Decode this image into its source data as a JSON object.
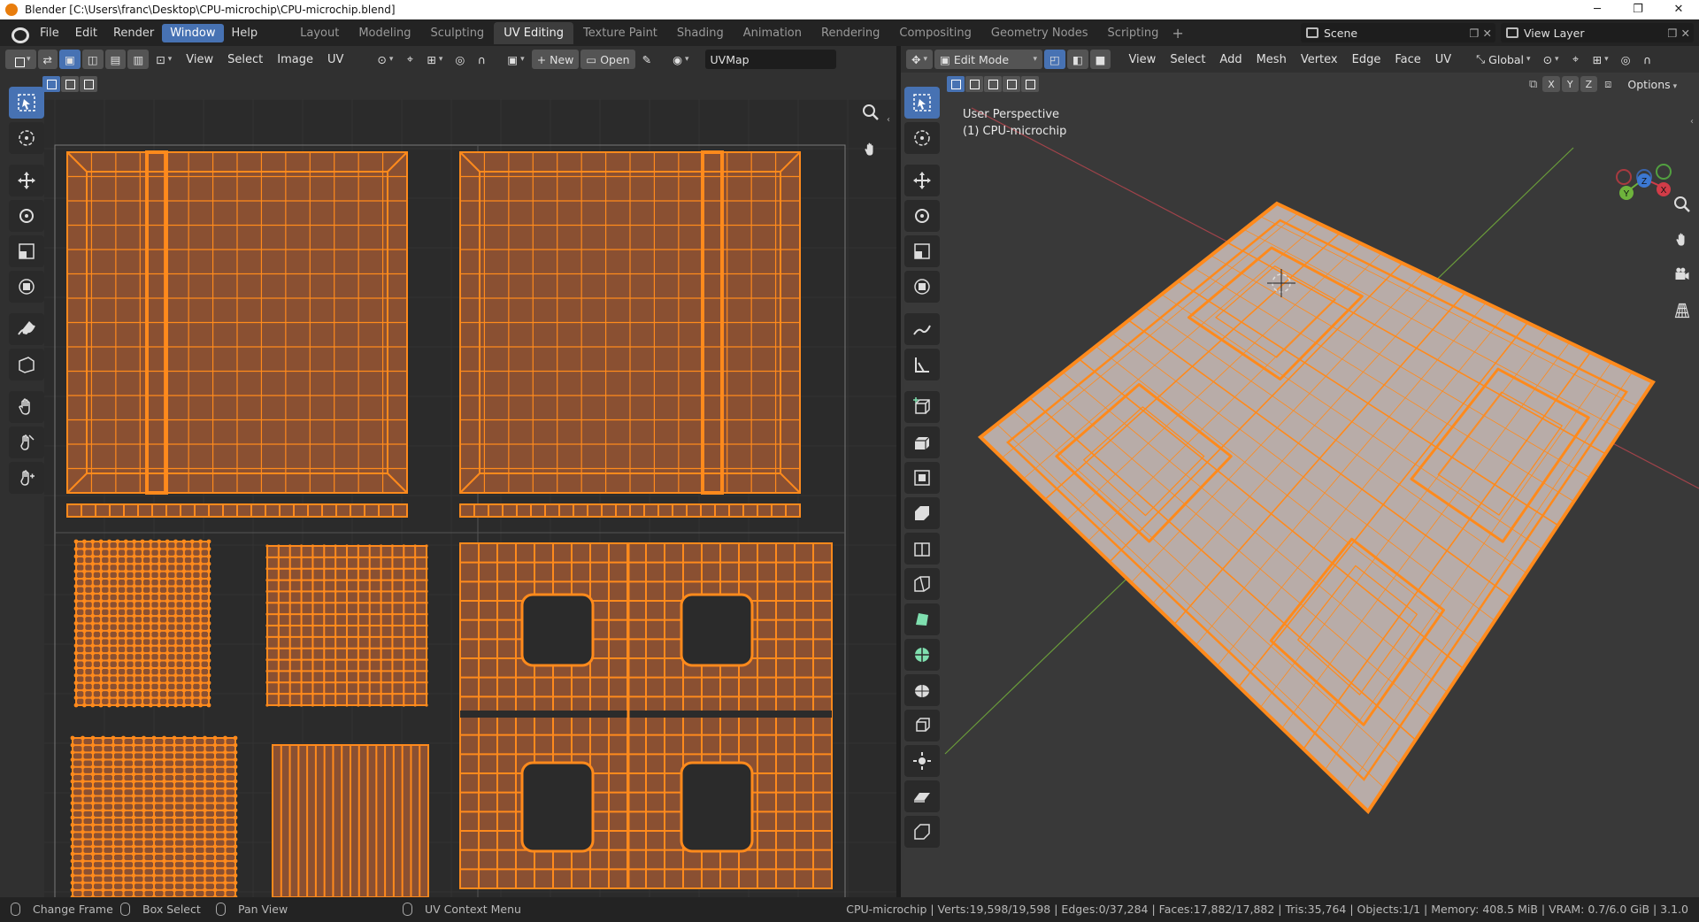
{
  "window": {
    "title": "Blender [C:\\Users\\franc\\Desktop\\CPU-microchip\\CPU-microchip.blend]",
    "minimize": "─",
    "maximize": "❐",
    "close": "✕"
  },
  "menu": {
    "items": [
      "File",
      "Edit",
      "Render",
      "Window",
      "Help"
    ],
    "active": "Window"
  },
  "workspaces": {
    "tabs": [
      "Layout",
      "Modeling",
      "Sculpting",
      "UV Editing",
      "Texture Paint",
      "Shading",
      "Animation",
      "Rendering",
      "Compositing",
      "Geometry Nodes",
      "Scripting"
    ],
    "active": "UV Editing",
    "add": "+"
  },
  "scene": {
    "label": "Scene",
    "view_layer": "View Layer"
  },
  "uv_editor": {
    "menus": [
      "View",
      "Select",
      "Image",
      "UV"
    ],
    "new_label": "New",
    "open_label": "Open",
    "uvmap": "UVMap"
  },
  "viewport": {
    "mode": "Edit Mode",
    "menus": [
      "View",
      "Select",
      "Add",
      "Mesh",
      "Vertex",
      "Edge",
      "Face",
      "UV"
    ],
    "orientation": "Global",
    "axis_x": "X",
    "axis_y": "Y",
    "axis_z": "Z",
    "options": "Options",
    "perspective": "User Perspective",
    "object_label": "(1) CPU-microchip",
    "gizmo_y": "Y",
    "gizmo_z": "Z",
    "gizmo_x": "X"
  },
  "status": {
    "change_frame": "Change Frame",
    "box_select": "Box Select",
    "pan_view": "Pan View",
    "uv_context": "UV Context Menu",
    "stats": "CPU-microchip | Verts:19,598/19,598 | Edges:0/37,284 | Faces:17,882/17,882 | Tris:35,764 | Objects:1/1 | Memory: 408.5 MiB | VRAM: 0.7/6.0 GiB | 3.1.0"
  },
  "colors": {
    "accent": "#4772b3",
    "mesh": "#ff8a1c",
    "face": "#8a5032",
    "surface": "#b8aca8",
    "background": "#303030"
  }
}
